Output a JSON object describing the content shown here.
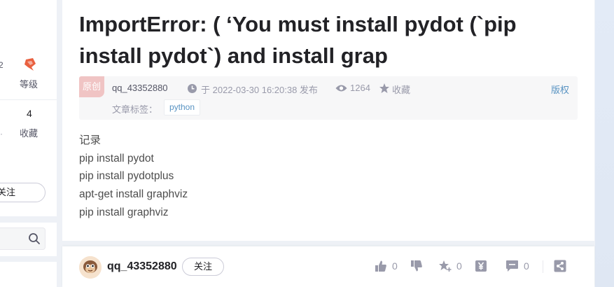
{
  "sidebar": {
    "level_number": "2",
    "level_label": "等级",
    "collect_count": "4",
    "collect_label": "收藏",
    "follow_label": "关注"
  },
  "article": {
    "title": "ImportError: ( ‘You must install pydot (`pip install pydot`) and install grap",
    "original_badge": "原创",
    "author": "qq_43352880",
    "publish_text": "于 2022-03-30 16:20:38 发布",
    "views": "1264",
    "collect_label": "收藏",
    "copyright_label": "版权",
    "tags_label": "文章标签：",
    "tags": [
      "python"
    ],
    "content_lines": [
      "记录",
      "pip install pydot",
      "pip install pydotplus",
      "apt-get install graphviz",
      "pip install graphviz"
    ]
  },
  "bottom_bar": {
    "author": "qq_43352880",
    "follow_label": "关注",
    "like_count": "0",
    "collect_count": "0",
    "comment_count": "0"
  },
  "colors": {
    "link_blue": "#5893c2",
    "badge_red": "#f0c4c4",
    "level_icon": "#e96140"
  }
}
